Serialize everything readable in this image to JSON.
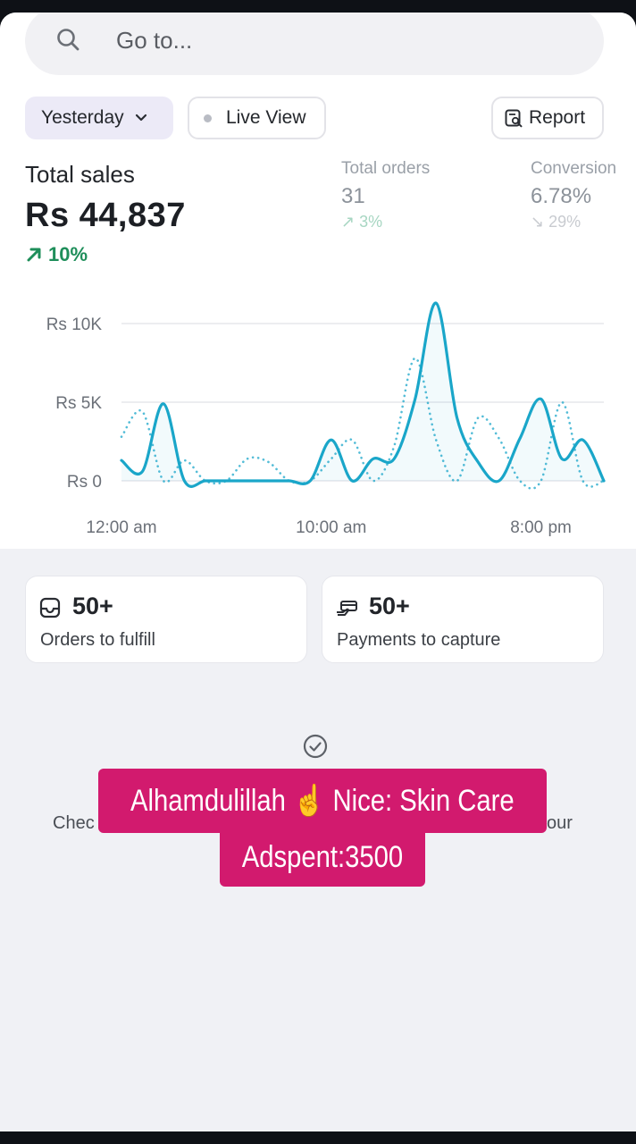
{
  "search": {
    "placeholder": "Go to..."
  },
  "filters": {
    "date_label": "Yesterday",
    "live_label": "Live View",
    "report_label": "Report"
  },
  "metrics": {
    "total_sales": {
      "label": "Total sales",
      "value": "Rs 44,837",
      "change": "10%"
    },
    "total_orders": {
      "label": "Total orders",
      "value": "31",
      "change": "3%"
    },
    "conversion": {
      "label": "Conversion",
      "value": "6.78%",
      "change": "29%"
    }
  },
  "chart_data": {
    "type": "line",
    "x_tick_labels": [
      "12:00 am",
      "10:00 am",
      "8:00 pm"
    ],
    "y_tick_labels": [
      "Rs 10K",
      "Rs 5K",
      "Rs 0"
    ],
    "ylim": [
      0,
      10000
    ],
    "x_range": [
      0,
      23
    ],
    "grid": true,
    "series": [
      {
        "style": "solid",
        "color": "#1aa6c9",
        "x": [
          0,
          1,
          2,
          3,
          4,
          5,
          6,
          7,
          8,
          9,
          10,
          11,
          12,
          13,
          14,
          15,
          16,
          17,
          18,
          19,
          20,
          21,
          22,
          23
        ],
        "values": [
          1300,
          600,
          4900,
          0,
          0,
          0,
          0,
          0,
          0,
          0,
          2600,
          0,
          1400,
          1400,
          5200,
          11300,
          4000,
          1200,
          0,
          2700,
          5200,
          1400,
          2600,
          0
        ]
      },
      {
        "style": "dotted",
        "color": "#1aa6c9",
        "x": [
          0,
          1,
          2,
          3,
          4,
          5,
          6,
          7,
          8,
          9,
          10,
          11,
          12,
          13,
          14,
          15,
          16,
          17,
          18,
          19,
          20,
          21,
          22,
          23
        ],
        "values": [
          2800,
          4400,
          0,
          1300,
          0,
          0,
          1400,
          1200,
          0,
          0,
          1400,
          2600,
          0,
          2200,
          7800,
          2600,
          0,
          4000,
          2700,
          0,
          0,
          5000,
          0,
          0
        ]
      }
    ]
  },
  "tasks": [
    {
      "value": "50+",
      "label": "Orders to fulfill",
      "icon": "inbox-icon"
    },
    {
      "value": "50+",
      "label": "Payments to capture",
      "icon": "payment-icon"
    }
  ],
  "background_text": {
    "left": "Chec",
    "right": "our"
  },
  "overlay": {
    "line1": "Alhamdulillah ☝️ Nice: Skin Care",
    "line2": "Adspent:3500"
  },
  "colors": {
    "accent_line": "#1aa6c9",
    "positive": "#1e8e5a",
    "overlay_bg": "#d21a6e"
  }
}
